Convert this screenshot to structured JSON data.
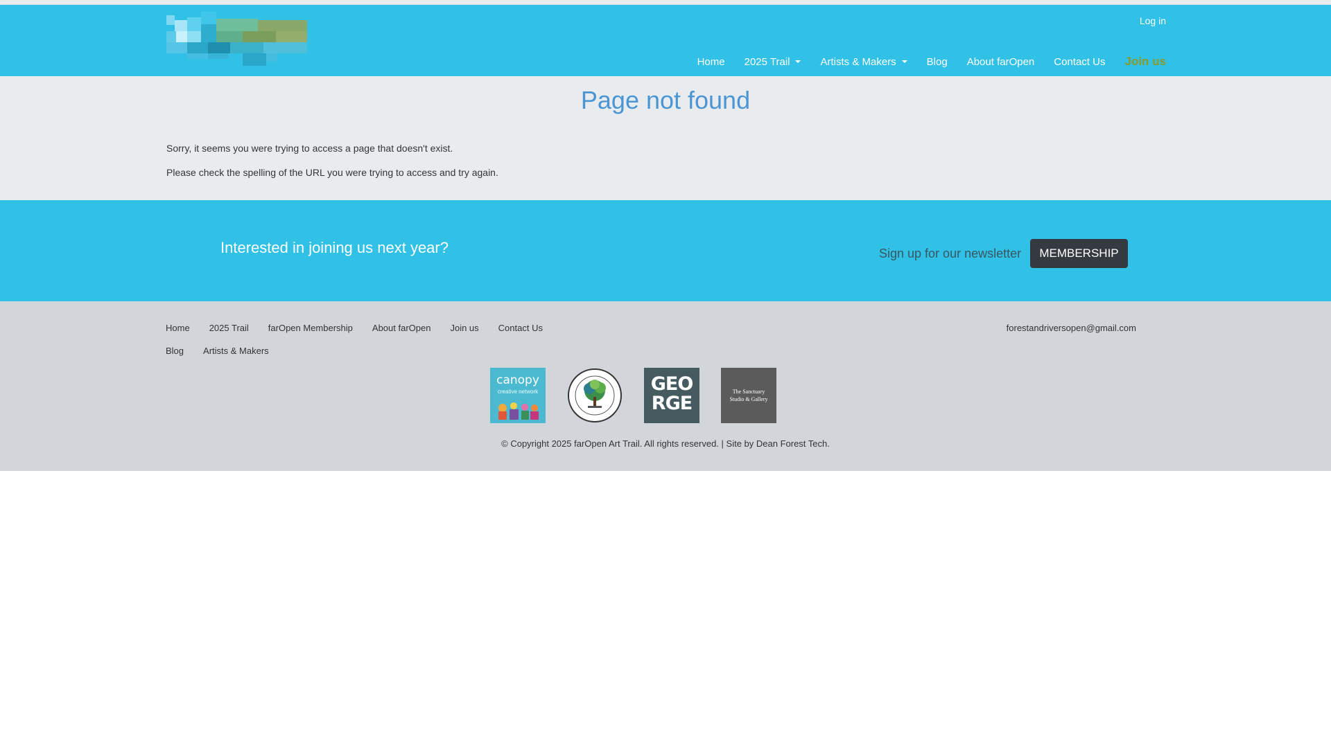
{
  "header": {
    "logo_name": "site-logo",
    "login_label": "Log in",
    "nav": [
      {
        "label": "Home",
        "dropdown": false
      },
      {
        "label": "2025 Trail",
        "dropdown": true
      },
      {
        "label": "Artists & Makers",
        "dropdown": true
      },
      {
        "label": "Blog",
        "dropdown": false
      },
      {
        "label": "About farOpen",
        "dropdown": false
      },
      {
        "label": "Contact Us",
        "dropdown": false
      }
    ],
    "join_label": "Join us"
  },
  "main": {
    "title": "Page not found",
    "message_1": "Sorry, it seems you were trying to access a page that doesn't exist.",
    "message_2": "Please check the spelling of the URL you were trying to access and try again."
  },
  "cta": {
    "question": "Interested in joining us next year?",
    "newsletter": "Sign up for our newsletter",
    "membership_button": "MEMBERSHIP"
  },
  "footer": {
    "links": [
      "Home",
      "2025 Trail",
      "farOpen Membership",
      "About farOpen",
      "Join us",
      "Contact Us",
      "Blog",
      "Artists & Makers"
    ],
    "email": "forestandriversopen@gmail.com",
    "sponsors": [
      {
        "name": "canopy-logo",
        "word": "canopy",
        "sub": "creative network"
      },
      {
        "name": "forest-market-logo"
      },
      {
        "name": "the-gorge-logo",
        "line1": "GEO",
        "line2": "RGE"
      },
      {
        "name": "sanctuary-logo",
        "line1": "The Sanctuary",
        "line2": "Studio & Gallery"
      }
    ],
    "copyright": "© Copyright 2025 farOpen Art Trail. All rights reserved. | Site by Dean Forest Tech."
  },
  "colors": {
    "header_bg": "#31c0e6",
    "main_bg": "#e9ecef",
    "title": "#4c95d3",
    "join": "#8a9a2b",
    "button_bg": "#343a40",
    "footer_bg": "#d2d5da"
  }
}
